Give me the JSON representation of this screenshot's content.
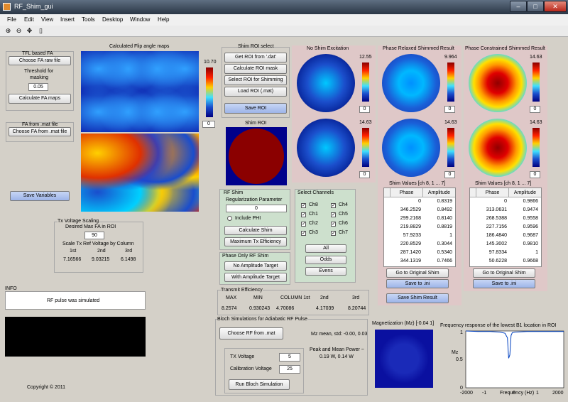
{
  "window": {
    "title": "RF_Shim_gui"
  },
  "menu": [
    "File",
    "Edit",
    "View",
    "Insert",
    "Tools",
    "Desktop",
    "Window",
    "Help"
  ],
  "tfl": {
    "title": "TFL based FA",
    "choose": "Choose FA raw file",
    "threshold_label1": "Threshold for",
    "threshold_label2": "masking",
    "threshold": "0.05",
    "calc": "Calculate FA maps"
  },
  "famat": {
    "title": "FA from .mat file",
    "choose": "Choose FA from .mat file"
  },
  "save_vars": "Save Variables",
  "fa_maps": {
    "title": "Calculated Flip angle maps",
    "cmax": "10.70",
    "cmin": "0"
  },
  "shim_roi": {
    "title": "Shim ROI select",
    "get": "Get ROI from '.dat'",
    "calc_mask": "Calculate ROI mask",
    "select": "Select ROI for Shimming",
    "load": "Load ROI (.mat)",
    "save": "Save ROI",
    "img_title": "Shim ROI"
  },
  "no_shim": {
    "title": "No Shim Excitation",
    "top_max": "12.55",
    "top_min": "0",
    "bot_max": "14.63",
    "bot_min": "0"
  },
  "relaxed": {
    "title": "Phase Relaxed Shimmed Result",
    "top_max": "9.964",
    "top_min": "0",
    "bot_max": "14.63",
    "bot_min": "0",
    "table_title": "Shim Values [ch 8, 1 ... 7]",
    "col_phase": "Phase",
    "col_amp": "Amplitude",
    "rows": [
      [
        "0",
        "0.8319"
      ],
      [
        "346.2529",
        "0.8492"
      ],
      [
        "299.2168",
        "0.8140"
      ],
      [
        "219.8829",
        "0.8819"
      ],
      [
        "57.9233",
        "1"
      ],
      [
        "220.8529",
        "0.3044"
      ],
      [
        "287.1420",
        "0.5340"
      ],
      [
        "344.1319",
        "0.7466"
      ]
    ],
    "btn_orig": "Go to Original Shim",
    "btn_ini": "Save to .ini",
    "btn_save": "Save Shim Result"
  },
  "constrained": {
    "title": "Phase Constrained Shimmed Result",
    "top_max": "14.63",
    "top_min": "0",
    "bot_max": "14.63",
    "bot_min": "0",
    "table_title": "Shim Values [ch 8, 1 ... 7]",
    "col_phase": "Phase",
    "col_amp": "Amplitude",
    "rows": [
      [
        "0",
        "0.9866"
      ],
      [
        "313.0631",
        "0.9474"
      ],
      [
        "268.5388",
        "0.9558"
      ],
      [
        "227.7156",
        "0.9596"
      ],
      [
        "186.4840",
        "0.9687"
      ],
      [
        "145.3002",
        "0.9810"
      ],
      [
        "97.8334",
        "1"
      ],
      [
        "50.6228",
        "0.9668"
      ]
    ],
    "btn_orig": "Go to Original Shim",
    "btn_ini": "Save to .ini"
  },
  "rfshim": {
    "title": "RF Shim",
    "reg_label": "Regularization Parameter",
    "reg": "0",
    "include_phi": "Include PHI",
    "calc": "Calculate Shim",
    "maxtx": "Maximum Tx Efficiency"
  },
  "phase_only": {
    "title": "Phase Only RF Shim",
    "noamp": "No Amplitude Target",
    "withamp": "With Amplitude Target"
  },
  "channels": {
    "title": "Select Channels",
    "left": [
      "Ch8",
      "Ch1",
      "Ch2",
      "Ch3"
    ],
    "right": [
      "Ch4",
      "Ch5",
      "Ch6",
      "Ch7"
    ],
    "all": "All",
    "odds": "Odds",
    "evens": "Evens"
  },
  "txscale": {
    "title": "Tx Voltage Scaling",
    "desired": "Desired Max FA in ROI",
    "value": "90",
    "scale_label": "Scale Tx Ref Voltage by Column",
    "cols": [
      "1st",
      "2nd",
      "3rd"
    ],
    "vals": [
      "7.16566",
      "9.03215",
      "6.1498"
    ]
  },
  "info": {
    "title": "INFO",
    "msg": "RF pulse was simulated"
  },
  "tx_eff": {
    "title": "Transmit Efficiency",
    "headers": [
      "MAX",
      "MIN",
      "COLUMN 1st",
      "2nd",
      "3rd"
    ],
    "values": [
      "8.2574",
      "0.930243",
      "4.70086",
      "4.17039",
      "8.20744"
    ]
  },
  "bloch": {
    "title": "Bloch Simulations for Adiabatic RF Pulse",
    "choose": "Choose RF from .mat",
    "mz_stats": "Mz mean, std: -0.00, 0.03",
    "power1": "Peak and Mean Power ~",
    "power2": "0.19 W, 0.14 W",
    "tx_label": "TX Voltage",
    "tx": "5",
    "cal_label": "Calibration Voltage",
    "cal": "25",
    "run": "Run Bloch Simulation"
  },
  "mag": {
    "title": "Magnetization (Mz) [-0.04 1]"
  },
  "freq": {
    "title": "Frequency response of the lowest B1 location in ROI",
    "ylabel": "Mz",
    "xlabel": "Frequency (Hz)",
    "xticks": [
      "-2000",
      "-1",
      "0",
      "1",
      "2000"
    ],
    "yticks": [
      "1",
      "0.5",
      "0"
    ],
    "chart_data": {
      "type": "line",
      "title": "Frequency response of the lowest B1 location in ROI",
      "xlabel": "Frequency (Hz)",
      "ylabel": "Mz",
      "xlim": [
        -2000,
        2000
      ],
      "ylim": [
        0,
        1
      ],
      "x": [
        -2000,
        -1500,
        -1000,
        -600,
        -400,
        -300,
        -250,
        -200,
        -150,
        -100,
        0,
        500,
        1000,
        1500,
        2000
      ],
      "y": [
        1,
        0.99,
        0.99,
        0.98,
        0.96,
        0.88,
        0.52,
        0.58,
        0.92,
        0.97,
        0.98,
        0.99,
        0.99,
        0.99,
        0.99
      ]
    }
  },
  "copyright": "Copyright © 2011"
}
